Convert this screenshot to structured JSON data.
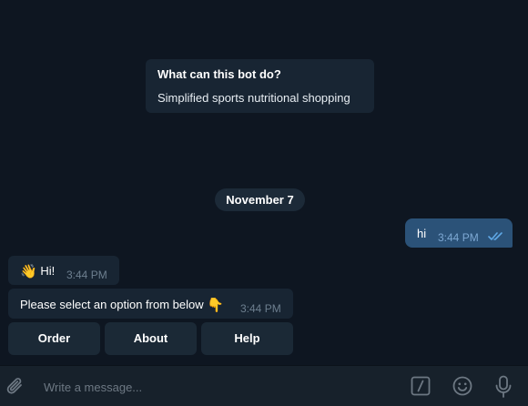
{
  "bot_info": {
    "title": "What can this bot do?",
    "description": "Simplified sports nutritional shopping"
  },
  "date_separator": "November 7",
  "messages": [
    {
      "direction": "out",
      "text": "hi",
      "time": "3:44 PM",
      "status": "read"
    },
    {
      "direction": "in",
      "emoji": "👋",
      "text": "Hi!",
      "time": "3:44 PM"
    },
    {
      "direction": "in",
      "text": "Please select an option from below",
      "emoji": "👇",
      "time": "3:44 PM"
    }
  ],
  "keyboard": {
    "buttons": [
      "Order",
      "About",
      "Help"
    ]
  },
  "composer": {
    "placeholder": "Write a message...",
    "icons": [
      "paperclip-icon",
      "bot-command-icon",
      "emoji-icon",
      "microphone-icon"
    ]
  },
  "colors": {
    "background": "#0e1621",
    "incoming_bubble": "#182533",
    "outgoing_bubble": "#2b5278",
    "composer": "#17212b",
    "read_ticks": "#5fa8e6"
  }
}
